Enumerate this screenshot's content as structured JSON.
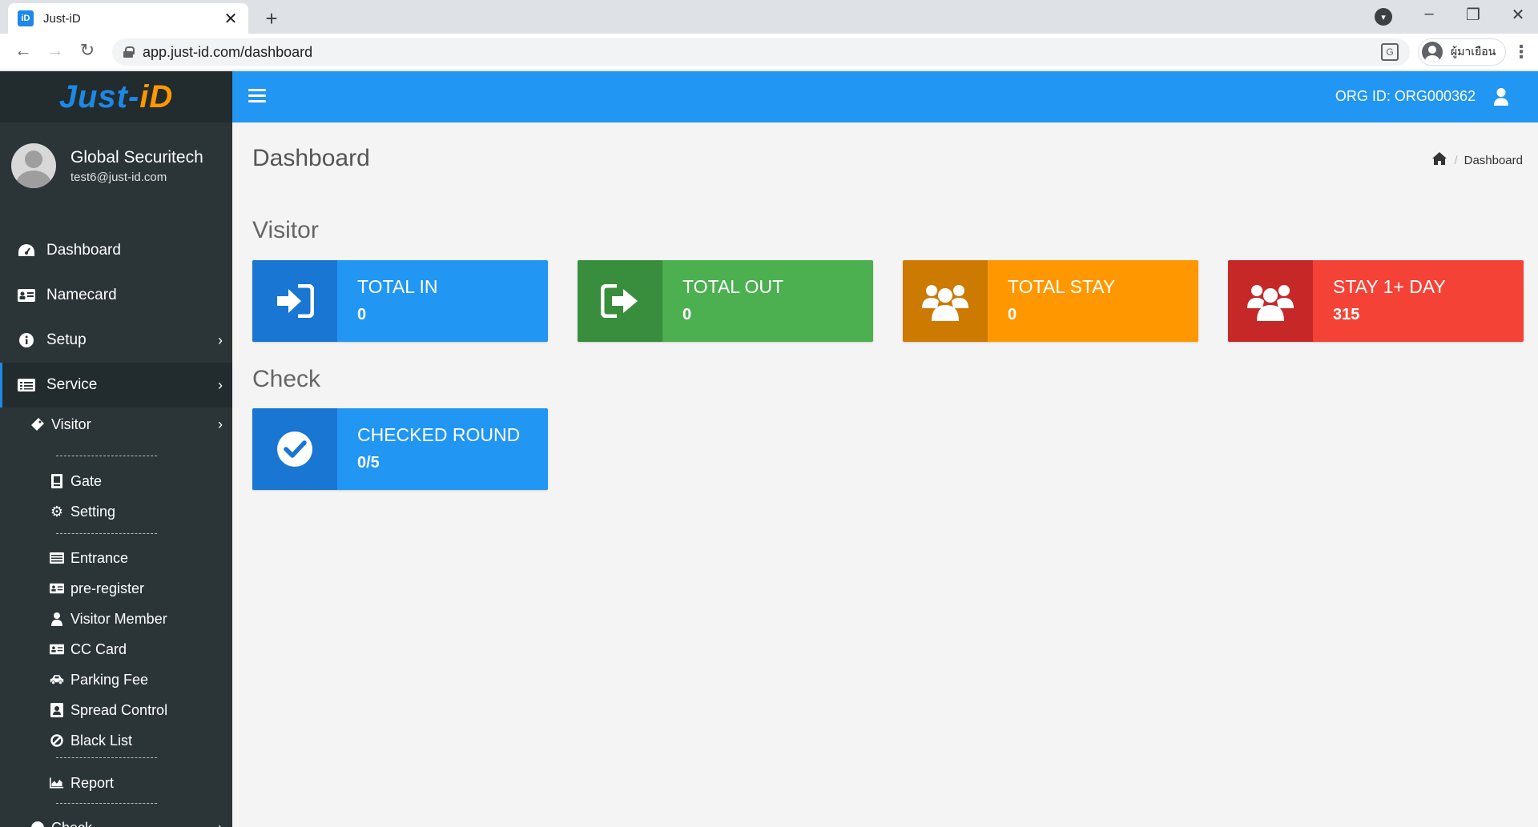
{
  "browser": {
    "tab_title": "Just-iD",
    "tab_close": "✕",
    "new_tab": "+",
    "url": "app.just-id.com/dashboard",
    "profile_name": "ผู้มาเยือน",
    "favicon_text": "iD"
  },
  "sidebar": {
    "logo_part1": "Just-",
    "logo_part2": "iD",
    "user_name": "Global Securitech",
    "user_email": "test6@just-id.com",
    "menu": [
      {
        "label": "Dashboard",
        "icon": "dashboard-icon"
      },
      {
        "label": "Namecard",
        "icon": "id-card-icon"
      },
      {
        "label": "Setup",
        "icon": "info-icon"
      },
      {
        "label": "Service",
        "icon": "list-icon"
      }
    ],
    "visitor_label": "Visitor",
    "sub_items": [
      {
        "label": "Gate",
        "icon": "gate-icon"
      },
      {
        "label": "Setting",
        "icon": "gear-icon"
      },
      {
        "label": "Entrance",
        "icon": "list-icon"
      },
      {
        "label": "pre-register",
        "icon": "id-card-icon"
      },
      {
        "label": "Visitor Member",
        "icon": "user-icon"
      },
      {
        "label": "CC Card",
        "icon": "id-card-icon"
      },
      {
        "label": "Parking Fee",
        "icon": "car-icon"
      },
      {
        "label": "Spread Control",
        "icon": "contact-icon"
      },
      {
        "label": "Black List",
        "icon": "ban-icon"
      },
      {
        "label": "Report",
        "icon": "chart-icon"
      }
    ],
    "check_label": "Check"
  },
  "topbar": {
    "org_id": "ORG ID: ORG000362"
  },
  "page": {
    "title": "Dashboard",
    "breadcrumb": "Dashboard"
  },
  "visitor_section": {
    "title": "Visitor",
    "boxes": [
      {
        "label": "TOTAL IN",
        "value": "0",
        "color": "#2196f3",
        "icon_bg": "#1976d2",
        "icon": "sign-in-icon"
      },
      {
        "label": "TOTAL OUT",
        "value": "0",
        "color": "#4caf50",
        "icon_bg": "#388e3c",
        "icon": "sign-out-icon"
      },
      {
        "label": "TOTAL STAY",
        "value": "0",
        "color": "#ff9800",
        "icon_bg": "#cc7a00",
        "icon": "users-icon"
      },
      {
        "label": "STAY 1+ DAY",
        "value": "315",
        "color": "#f44336",
        "icon_bg": "#c62828",
        "icon": "users-icon"
      }
    ]
  },
  "check_section": {
    "title": "Check",
    "boxes": [
      {
        "label": "CHECKED ROUND",
        "value": "0/5",
        "color": "#2196f3",
        "icon_bg": "#1976d2",
        "icon": "check-circle-icon"
      }
    ]
  }
}
